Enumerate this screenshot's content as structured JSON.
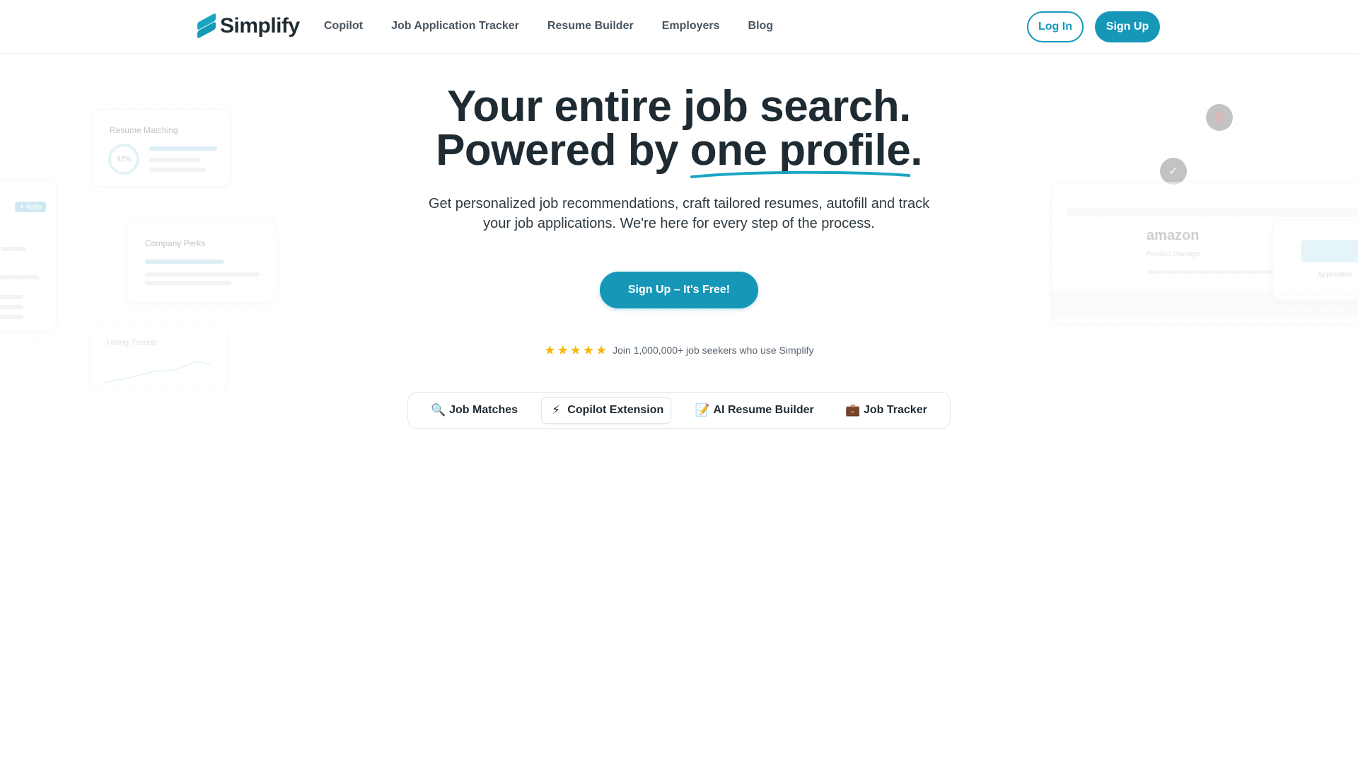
{
  "brand": {
    "name": "Simplify",
    "accent": "#1697b8"
  },
  "nav": {
    "items": [
      {
        "label": "Copilot"
      },
      {
        "label": "Job Application Tracker"
      },
      {
        "label": "Resume Builder"
      },
      {
        "label": "Employers"
      },
      {
        "label": "Blog"
      }
    ],
    "login_label": "Log In",
    "signup_label": "Sign Up"
  },
  "hero": {
    "title_line1": "Your entire job search.",
    "title_line2_prefix": "Powered by ",
    "title_line2_highlight": "one profile",
    "title_line2_suffix": ".",
    "subtitle_line1": "Get personalized job recommendations, craft tailored resumes, autofill and track",
    "subtitle_line2": "your job applications. We're here for every step of the process.",
    "cta_label": "Sign Up – It's Free!",
    "rating_stars": 5,
    "social_proof": "Join 1,000,000+ job seekers who use Simplify"
  },
  "tabs": [
    {
      "label": "Job Matches",
      "icon": "magnifier-icon",
      "glyph": "🔍",
      "active": false
    },
    {
      "label": "Copilot Extension",
      "icon": "lightning-icon",
      "glyph": "⚡",
      "active": true
    },
    {
      "label": "AI Resume Builder",
      "icon": "memo-icon",
      "glyph": "📝",
      "active": false
    },
    {
      "label": "Job Tracker",
      "icon": "briefcase-icon",
      "glyph": "💼",
      "active": false
    }
  ],
  "decor": {
    "resume_matching_title": "Resume Matching",
    "resume_matching_score": "92%",
    "apply_pill": "✦ Apply",
    "company_perks_title": "Company Perks",
    "hiring_trends_title": "Hiring Trends",
    "netflix_letter": "N",
    "nike_glyph": "✓",
    "amazon_logo": "amazon",
    "amazon_role": "Product Manager",
    "application_label": "Application"
  }
}
